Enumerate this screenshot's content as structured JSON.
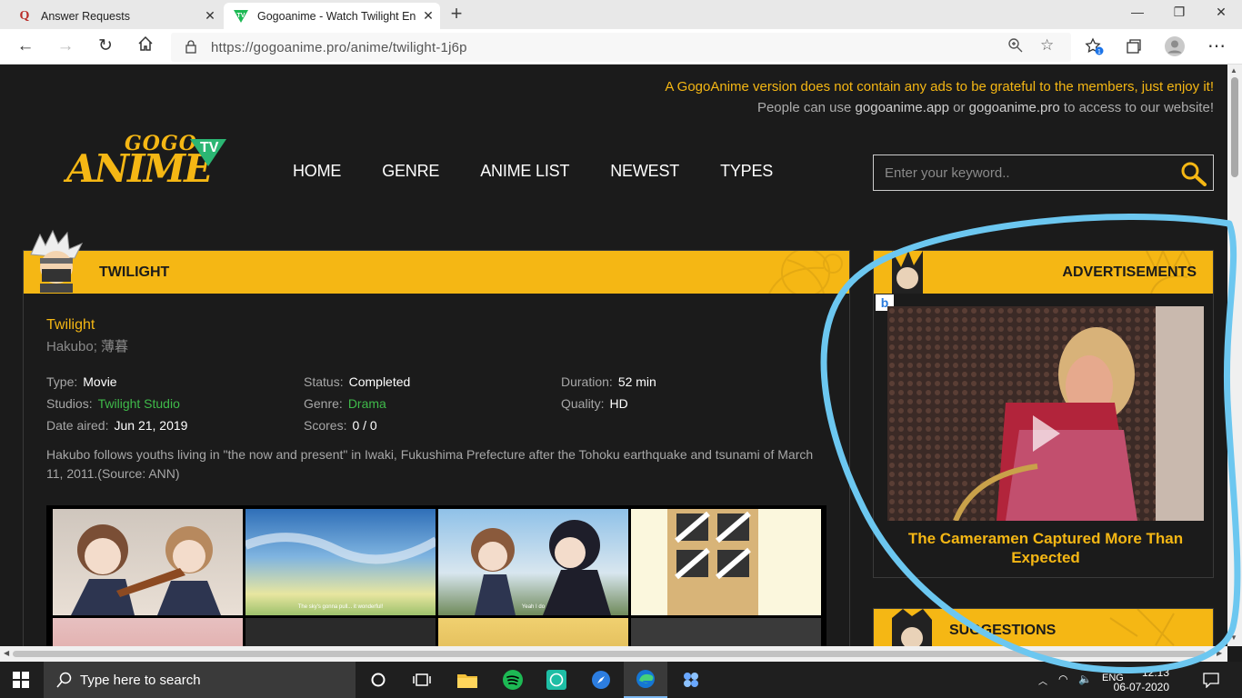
{
  "browser": {
    "tabs": [
      {
        "title": "Answer Requests",
        "icon": "quora-icon"
      },
      {
        "title": "Gogoanime - Watch Twilight Eng",
        "icon": "gogoanime-icon"
      }
    ],
    "url": "https://gogoanime.pro/anime/twilight-1j6p"
  },
  "notice": {
    "line1": "A GogoAnime version does not contain any ads to be grateful to the members, just enjoy it!",
    "line2_prefix": "People can use",
    "link1": "gogoanime.app",
    "line2_or": "or",
    "link2": "gogoanime.pro",
    "line2_suffix": "to access to our website!"
  },
  "logo": {
    "top": "GOGO",
    "main": "ANIME",
    "badge": "TV"
  },
  "nav": [
    "HOME",
    "GENRE",
    "ANIME LIST",
    "NEWEST",
    "TYPES"
  ],
  "search": {
    "placeholder": "Enter your keyword.."
  },
  "anime": {
    "section_title": "TWILIGHT",
    "title": "Twilight",
    "other_names": "Hakubo; 薄暮",
    "type_label": "Type:",
    "type": "Movie",
    "studios_label": "Studios:",
    "studios": "Twilight Studio",
    "date_label": "Date aired:",
    "date": "Jun 21, 2019",
    "status_label": "Status:",
    "status": "Completed",
    "genre_label": "Genre:",
    "genre": "Drama",
    "scores_label": "Scores:",
    "scores": "0 / 0",
    "duration_label": "Duration:",
    "duration": "52 min",
    "quality_label": "Quality:",
    "quality": "HD",
    "description": "Hakubo follows youths living in \"the now and present\" in Iwaki, Fukushima Prefecture after the Tohoku earthquake and tsunami of March 11, 2011.(Source: ANN)",
    "captions": [
      "The sky's gonna pull... it wonderful!",
      "Yeah I do"
    ]
  },
  "sidebar": {
    "ads_title": "ADVERTISEMENTS",
    "ad_badge": "b",
    "ad_headline": "The Cameramen Captured More Than Expected",
    "suggestions_title": "SUGGESTIONS"
  },
  "taskbar": {
    "search_placeholder": "Type here to search",
    "lang": "ENG",
    "time": "12:13",
    "date": "06-07-2020"
  },
  "colors": {
    "accent": "#f5b714",
    "green_link": "#3fba4a",
    "annotation": "#6cc7f0"
  }
}
